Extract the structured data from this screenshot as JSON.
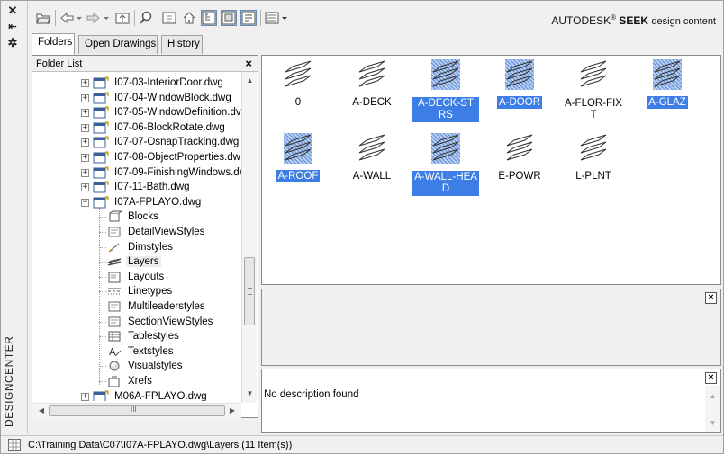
{
  "palette_title": "DESIGNCENTER",
  "brand": {
    "name": "AUTODESK",
    "registered": "®",
    "product": "SEEK",
    "suffix": "design content"
  },
  "tabs": [
    {
      "label": "Folders",
      "active": true
    },
    {
      "label": "Open Drawings",
      "active": false
    },
    {
      "label": "History",
      "active": false
    }
  ],
  "folder_list": {
    "title": "Folder List",
    "close": "×",
    "items": [
      {
        "label": "I07-03-InteriorDoor.dwg",
        "type": "drawing",
        "expand": "+"
      },
      {
        "label": "I07-04-WindowBlock.dwg",
        "type": "drawing",
        "expand": "+"
      },
      {
        "label": "I07-05-WindowDefinition.dv",
        "type": "drawing",
        "expand": "+"
      },
      {
        "label": "I07-06-BlockRotate.dwg",
        "type": "drawing",
        "expand": "+"
      },
      {
        "label": "I07-07-OsnapTracking.dwg",
        "type": "drawing",
        "expand": "+"
      },
      {
        "label": "I07-08-ObjectProperties.dw",
        "type": "drawing",
        "expand": "+"
      },
      {
        "label": "I07-09-FinishingWindows.d\\",
        "type": "drawing",
        "expand": "+"
      },
      {
        "label": "I07-11-Bath.dwg",
        "type": "drawing",
        "expand": "+"
      },
      {
        "label": "I07A-FPLAYO.dwg",
        "type": "drawing",
        "expand": "−"
      },
      {
        "label": "Blocks",
        "type": "blocks-icon"
      },
      {
        "label": "DetailViewStyles",
        "type": "detail-view-styles-icon"
      },
      {
        "label": "Dimstyles",
        "type": "dimstyles-icon"
      },
      {
        "label": "Layers",
        "type": "layers-icon",
        "selected": true
      },
      {
        "label": "Layouts",
        "type": "layouts-icon"
      },
      {
        "label": "Linetypes",
        "type": "linetypes-icon"
      },
      {
        "label": "Multileaderstyles",
        "type": "multileader-styles-icon"
      },
      {
        "label": "SectionViewStyles",
        "type": "section-view-styles-icon"
      },
      {
        "label": "Tablestyles",
        "type": "tablestyles-icon"
      },
      {
        "label": "Textstyles",
        "type": "textstyles-icon"
      },
      {
        "label": "Visualstyles",
        "type": "visualstyles-icon"
      },
      {
        "label": "Xrefs",
        "type": "xrefs-icon"
      },
      {
        "label": "M06A-FPLAYO.dwg",
        "type": "drawing",
        "expand": "+"
      }
    ],
    "hscroll_thumb_glyph": "III"
  },
  "layers": [
    {
      "name": "0",
      "selected": false
    },
    {
      "name": "A-DECK",
      "selected": false
    },
    {
      "name": "A-DECK-STRS",
      "selected": true
    },
    {
      "name": "A-DOOR",
      "selected": true
    },
    {
      "name": "A-FLOR-FIXT",
      "selected": false
    },
    {
      "name": "A-GLAZ",
      "selected": true
    },
    {
      "name": "A-ROOF",
      "selected": true
    },
    {
      "name": "A-WALL",
      "selected": false
    },
    {
      "name": "A-WALL-HEAD",
      "selected": true
    },
    {
      "name": "E-POWR",
      "selected": false
    },
    {
      "name": "L-PLNT",
      "selected": false
    }
  ],
  "preview": {
    "close": "×"
  },
  "description": {
    "text": "No description found",
    "close": "×"
  },
  "status": {
    "path": "C:\\Training Data\\C07\\I07A-FPLAYO.dwg\\Layers (11 Item(s))"
  },
  "colors": {
    "selection": "#3d7ee6",
    "toolbar_active": "#cfe0f5"
  }
}
